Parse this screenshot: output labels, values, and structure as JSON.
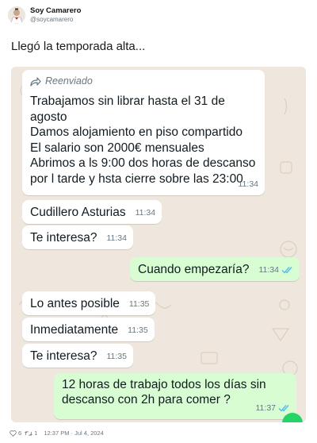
{
  "post": {
    "author_name": "Soy Camarero",
    "author_handle": "@soycamarero",
    "text": "Llegó la temporada alta...",
    "likes": "6",
    "retweets": "1",
    "timestamp": "12:37 PM · Jul 4, 2024"
  },
  "chat": {
    "forwarded_label": "Reenviado",
    "messages": [
      {
        "dir": "in",
        "text": "Trabajamos sin librar hasta el 31 de agosto\nDamos alojamiento en piso compartido\nEl salario son 2000€ mensuales\nAbrimos a ls 9:00 dos horas de descanso por l tarde y hsta cierre sobre las 23:00",
        "time": "11:34"
      },
      {
        "dir": "in",
        "text": "Cudillero Asturias",
        "time": "11:34"
      },
      {
        "dir": "in",
        "text": "Te interesa?",
        "time": "11:34"
      },
      {
        "dir": "out",
        "text": "Cuando empezaría?",
        "time": "11:34"
      },
      {
        "dir": "in",
        "text": "Lo antes posible",
        "time": "11:35"
      },
      {
        "dir": "in",
        "text": "Inmediatamente",
        "time": "11:35"
      },
      {
        "dir": "in",
        "text": "Te interesa?",
        "time": "11:35"
      },
      {
        "dir": "out",
        "text": "12 horas de trabajo todos los días sin descanso con 2h para comer ?",
        "time": "11:37"
      }
    ]
  },
  "colors": {
    "chat_background": "#efe7dd",
    "incoming_bubble": "#ffffff",
    "outgoing_bubble": "#d9fdd3",
    "read_ticks": "#53bdeb"
  }
}
